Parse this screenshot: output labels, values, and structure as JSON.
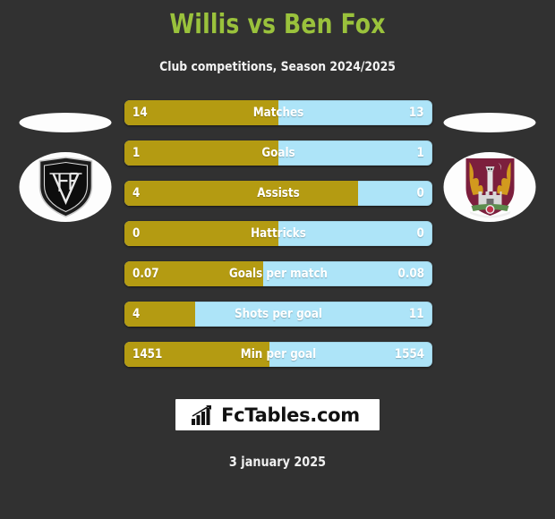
{
  "header": {
    "title": "Willis vs Ben Fox",
    "subtitle": "Club competitions, Season 2024/2025",
    "title_color": "#9ac23c"
  },
  "teams": {
    "home": {
      "crest_icon": "shield-crest-monogram-icon"
    },
    "away": {
      "crest_icon": "shield-crest-lions-castle-icon"
    }
  },
  "colors": {
    "background": "#313131",
    "home_bar": "#b49b12",
    "away_bar": "#ade4f8",
    "value_text": "#ffffff"
  },
  "chart_data": {
    "type": "bar",
    "title": "Willis vs Ben Fox",
    "subtitle": "Club competitions, Season 2024/2025",
    "orientation": "horizontal-diverging",
    "series": [
      {
        "name": "Willis",
        "color": "#b49b12",
        "values": [
          14,
          1,
          4,
          0,
          0.07,
          4,
          1451
        ]
      },
      {
        "name": "Ben Fox",
        "color": "#ade4f8",
        "values": [
          13,
          1,
          0,
          0,
          0.08,
          11,
          1554
        ]
      }
    ],
    "categories": [
      "Matches",
      "Goals",
      "Assists",
      "Hattricks",
      "Goals per match",
      "Shots per goal",
      "Min per goal"
    ],
    "grid": false,
    "legend": "none"
  },
  "stats": [
    {
      "label": "Matches",
      "home": "14",
      "away": "13",
      "home_pct": 50
    },
    {
      "label": "Goals",
      "home": "1",
      "away": "1",
      "home_pct": 50
    },
    {
      "label": "Assists",
      "home": "4",
      "away": "0",
      "home_pct": 76
    },
    {
      "label": "Hattricks",
      "home": "0",
      "away": "0",
      "home_pct": 50
    },
    {
      "label": "Goals per match",
      "home": "0.07",
      "away": "0.08",
      "home_pct": 45
    },
    {
      "label": "Shots per goal",
      "home": "4",
      "away": "11",
      "home_pct": 23
    },
    {
      "label": "Min per goal",
      "home": "1451",
      "away": "1554",
      "home_pct": 47
    }
  ],
  "footer": {
    "logo_text": "FcTables.com",
    "logo_icon": "bar-chart-icon",
    "date": "3 january 2025"
  }
}
